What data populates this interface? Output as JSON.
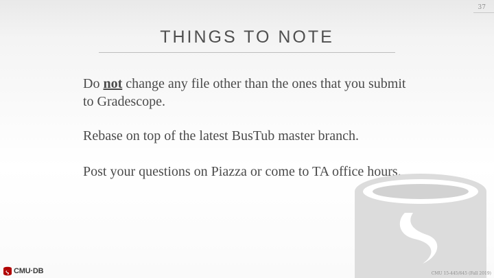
{
  "slide": {
    "page_number": "37",
    "title": "THINGS TO NOTE",
    "bullets": [
      {
        "before": "Do ",
        "emphasis": "not",
        "after": " change any file other than the ones that you submit to Gradescope."
      },
      {
        "text": "Rebase on top of the latest BusTub master branch."
      },
      {
        "text": "Post your questions on Piazza or come to TA office hours."
      }
    ]
  },
  "branding": {
    "logo_text": "CMU·DB",
    "logo_color": "#b00000",
    "footer": "CMU 15-445/645 (Fall 2019)"
  }
}
